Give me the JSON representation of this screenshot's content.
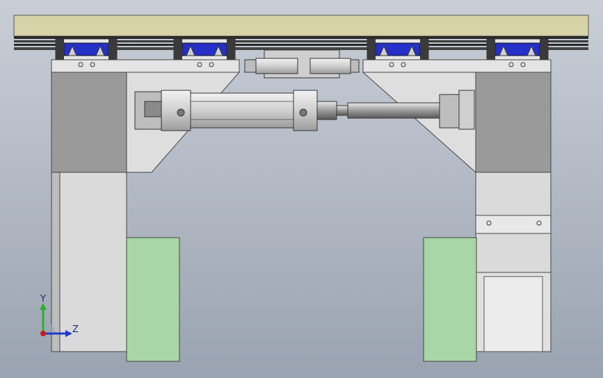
{
  "viewport": {
    "background_top": "#c9ced6",
    "background_bottom": "#9aa3b1"
  },
  "colors": {
    "rail": "#d6d3a9",
    "rail_dark": "#2a2a2a",
    "carriage_blue": "#2530c9",
    "frame_light": "#dcdcdc",
    "frame_dark": "#9a9a9a",
    "pad_green": "#a8d6a6",
    "cylinder": "#c8c8c8"
  },
  "triad": {
    "y_label": "Y",
    "z_label": "Z",
    "y_axis_color": "#2bb02b",
    "z_axis_color": "#1c3ccc",
    "origin_color": "#d01818",
    "icon": "coordinate-triad-icon"
  }
}
